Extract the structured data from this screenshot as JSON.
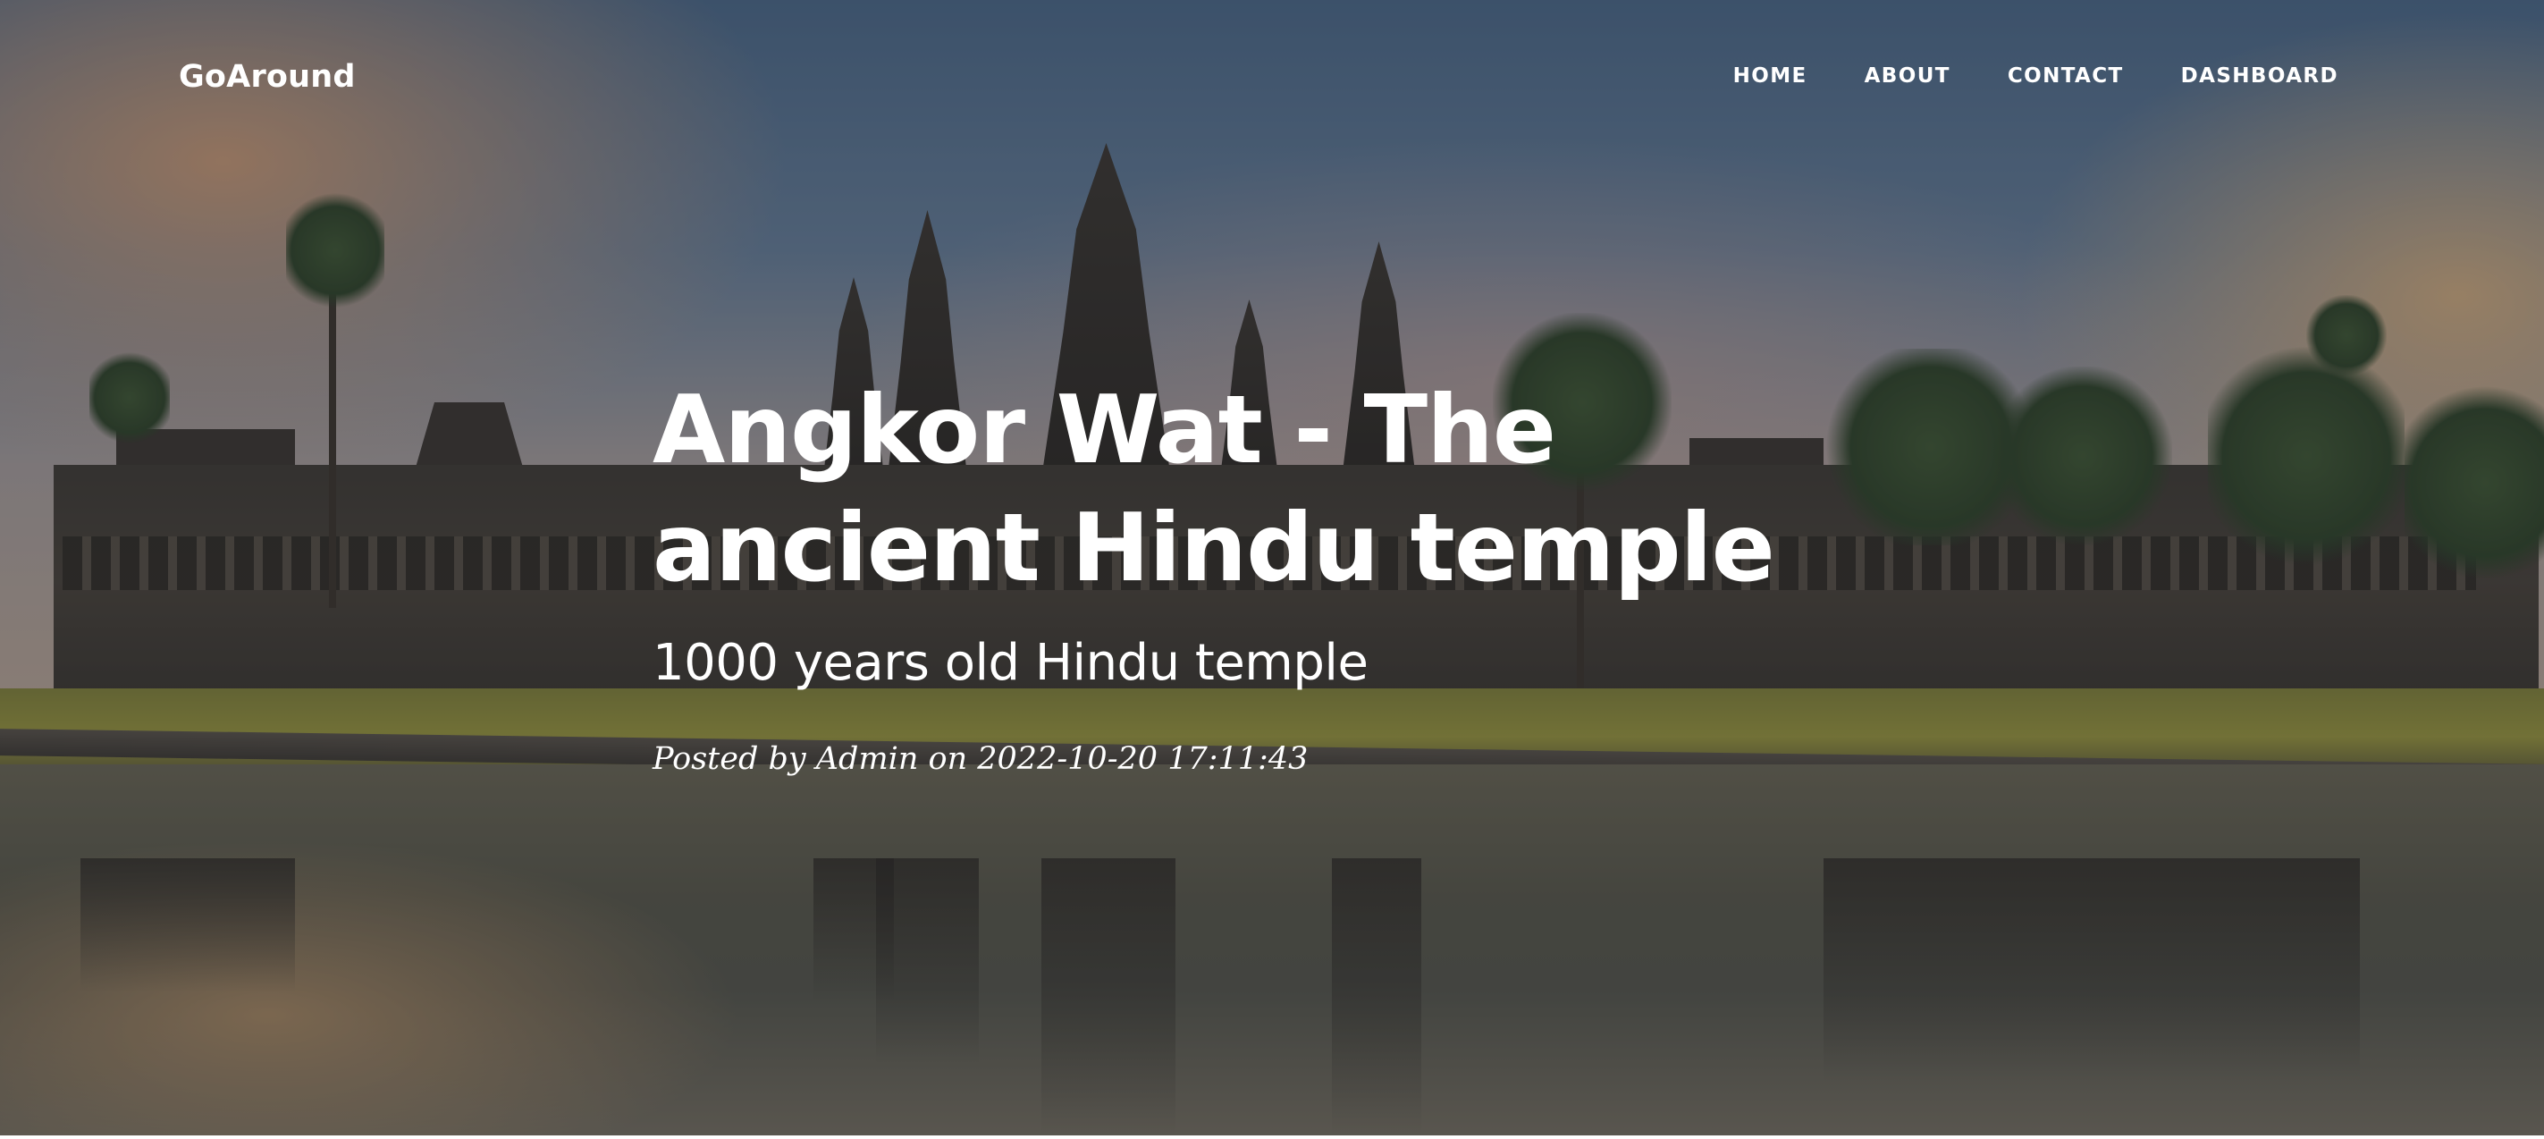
{
  "navbar": {
    "brand": "GoAround",
    "links": [
      {
        "label": "HOME"
      },
      {
        "label": "ABOUT"
      },
      {
        "label": "CONTACT"
      },
      {
        "label": "DASHBOARD"
      }
    ]
  },
  "post": {
    "title": "Angkor Wat - The ancient Hindu temple",
    "subtitle": "1000 years old Hindu temple",
    "meta_prefix": "Posted by ",
    "author": "Admin",
    "meta_on": " on ",
    "date": "2022-10-20 17:11:43"
  },
  "hero": {
    "background_description_icon": "angkor-wat-photo",
    "overlay_color": "#212529"
  }
}
